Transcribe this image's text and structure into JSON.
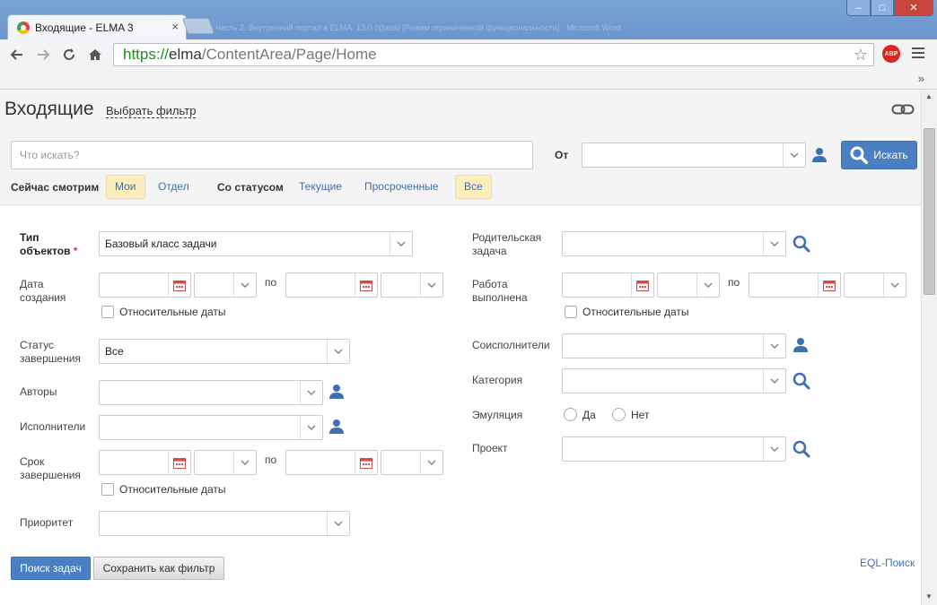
{
  "browser": {
    "tab_title": "Входящие - ELMA 3",
    "tab_close": "×",
    "titlebar_ghost": "Часть 2. Внутренний портал в ELMA. 13.0.0(beta) [Режим ограниченной функциональности] · Microsoft Word",
    "url_scheme": "https://",
    "url_host": "elma",
    "url_path": "/ContentArea/Page/Home",
    "abp_label": "ABP",
    "bookmarks_more": "»",
    "win_min": "–",
    "win_max": "□",
    "win_close": "✕"
  },
  "header": {
    "title": "Входящие",
    "filter_link": "Выбрать фильтр"
  },
  "search": {
    "placeholder": "Что искать?",
    "from_label": "От",
    "button_label": "Искать"
  },
  "view_filters": {
    "watching_label": "Сейчас смотрим",
    "mine": "Мои",
    "department": "Отдел",
    "status_label": "Со статусом",
    "current": "Текущие",
    "overdue": "Просроченные",
    "all": "Все"
  },
  "form": {
    "object_type_label_1": "Тип",
    "object_type_label_2": "объектов",
    "required_mark": "*",
    "object_type_value": "Базовый класс задачи",
    "created_label_1": "Дата",
    "created_label_2": "создания",
    "po": "по",
    "relative_dates": "Относительные даты",
    "completion_status_label_1": "Статус",
    "completion_status_label_2": "завершения",
    "completion_status_value": "Все",
    "authors_label": "Авторы",
    "executors_label": "Исполнители",
    "deadline_label_1": "Срок",
    "deadline_label_2": "завершения",
    "priority_label": "Приоритет",
    "parent_task_label_1": "Родительская",
    "parent_task_label_2": "задача",
    "work_done_label_1": "Работа",
    "work_done_label_2": "выполнена",
    "coexecutors_label": "Соисполнители",
    "category_label": "Категория",
    "emulation_label": "Эмуляция",
    "yes": "Да",
    "no": "Нет",
    "project_label": "Проект"
  },
  "actions": {
    "search_tasks": "Поиск задач",
    "save_as_filter": "Сохранить как фильтр",
    "eql_search": "EQL-Поиск"
  },
  "colors": {
    "accent": "#4a7fc1",
    "chip_active": "#fbeeba",
    "link": "#3f6fb3",
    "icon_blue": "#3f6fb3"
  }
}
